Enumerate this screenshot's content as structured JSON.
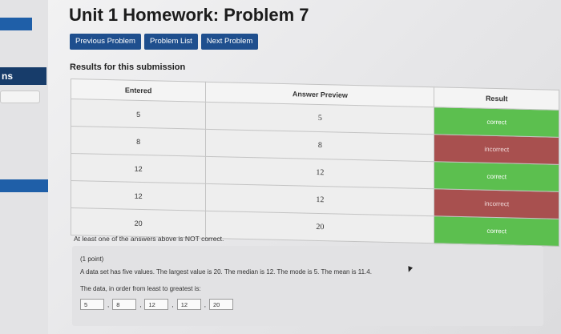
{
  "sidebar": {
    "nav_label": "ns"
  },
  "page": {
    "title": "Unit 1 Homework: Problem 7"
  },
  "toolbar": {
    "previous_label": "Previous Problem",
    "list_label": "Problem List",
    "next_label": "Next Problem"
  },
  "results": {
    "heading": "Results for this submission",
    "columns": [
      "Entered",
      "Answer Preview",
      "Result"
    ],
    "rows": [
      {
        "entered": "5",
        "preview": "5",
        "result": "correct"
      },
      {
        "entered": "8",
        "preview": "8",
        "result": "incorrect"
      },
      {
        "entered": "12",
        "preview": "12",
        "result": "correct"
      },
      {
        "entered": "12",
        "preview": "12",
        "result": "incorrect"
      },
      {
        "entered": "20",
        "preview": "20",
        "result": "correct"
      }
    ],
    "note": "At least one of the answers above is NOT correct."
  },
  "problem": {
    "points": "(1 point)",
    "statement": "A data set has five values. The largest value is 20. The median is 12. The mode is 5. The mean is 11.4.",
    "instruction": "The data, in order from least to greatest is:",
    "answers": [
      "5",
      "8",
      "12",
      "12",
      "20"
    ],
    "separator": ","
  },
  "colors": {
    "correct": "#5cbf4f",
    "incorrect": "#a8504f",
    "button": "#1f4f8e"
  }
}
